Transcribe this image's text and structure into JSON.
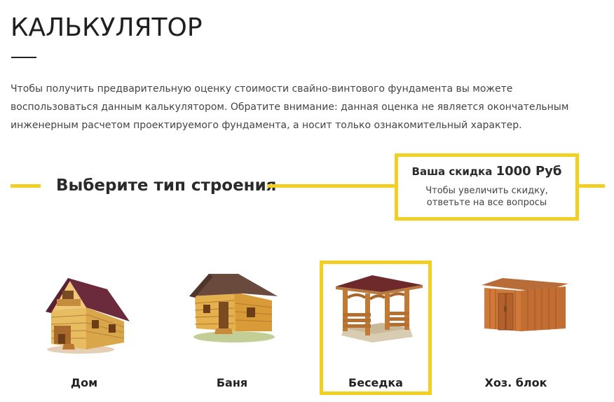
{
  "page": {
    "title": "КАЛЬКУЛЯТОР",
    "intro": "Чтобы получить предварительную оценку стоимости свайно-винтового фундамента вы можете воспользоваться данным калькулятором. Обратите внимание: данная оценка не является окончательным инженерным расчетом проектируемого фундамента, а носит только ознакомительный характер."
  },
  "section": {
    "title": "Выберите тип строения"
  },
  "discount": {
    "label": "Ваша скидка",
    "amount": "1000 Руб",
    "note_line1": "Чтобы увеличить скидку,",
    "note_line2": "ответьте на все вопросы"
  },
  "options": [
    {
      "label": "Дом",
      "icon": "house-icon",
      "selected": false
    },
    {
      "label": "Баня",
      "icon": "bathhouse-icon",
      "selected": false
    },
    {
      "label": "Беседка",
      "icon": "gazebo-icon",
      "selected": true
    },
    {
      "label": "Хоз. блок",
      "icon": "shed-icon",
      "selected": false
    }
  ],
  "colors": {
    "accent": "#f2cf23",
    "text": "#222222"
  }
}
